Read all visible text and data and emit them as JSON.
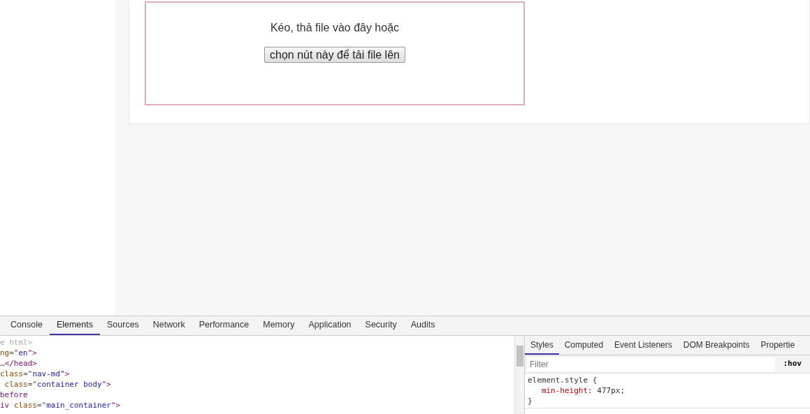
{
  "upload_box": {
    "prompt": "Kéo, thả file vào đây hoặc",
    "button": "chọn nút này để tải file lên"
  },
  "devtools": {
    "tabs": [
      {
        "label": "Console",
        "selected": false
      },
      {
        "label": "Elements",
        "selected": true
      },
      {
        "label": "Sources",
        "selected": false
      },
      {
        "label": "Network",
        "selected": false
      },
      {
        "label": "Performance",
        "selected": false
      },
      {
        "label": "Memory",
        "selected": false
      },
      {
        "label": "Application",
        "selected": false
      },
      {
        "label": "Security",
        "selected": false
      },
      {
        "label": "Audits",
        "selected": false
      }
    ],
    "dom_lines": [
      [
        {
          "kind": "doctype",
          "text": "e html>"
        }
      ],
      [
        {
          "kind": "attr",
          "text": "ng"
        },
        {
          "kind": "plain",
          "text": "=\""
        },
        {
          "kind": "value",
          "text": "en"
        },
        {
          "kind": "tag",
          "text": "\">"
        }
      ],
      [
        {
          "kind": "plain",
          "text": "…"
        },
        {
          "kind": "tag",
          "text": "</head>"
        }
      ],
      [
        {
          "kind": "attr",
          "text": "class"
        },
        {
          "kind": "plain",
          "text": "=\""
        },
        {
          "kind": "value",
          "text": "nav-md"
        },
        {
          "kind": "tag",
          "text": "\">"
        }
      ],
      [
        {
          "kind": "attr",
          "text": " class"
        },
        {
          "kind": "plain",
          "text": "=\""
        },
        {
          "kind": "value",
          "text": "container body"
        },
        {
          "kind": "tag",
          "text": "\">"
        }
      ],
      [
        {
          "kind": "pseudo",
          "text": "before"
        }
      ],
      [
        {
          "kind": "tag",
          "text": "iv "
        },
        {
          "kind": "attr",
          "text": "class"
        },
        {
          "kind": "plain",
          "text": "=\""
        },
        {
          "kind": "value",
          "text": "main_container"
        },
        {
          "kind": "tag",
          "text": "\">"
        }
      ]
    ],
    "side_tabs": [
      {
        "label": "Styles",
        "selected": true
      },
      {
        "label": "Computed",
        "selected": false
      },
      {
        "label": "Event Listeners",
        "selected": false
      },
      {
        "label": "DOM Breakpoints",
        "selected": false
      },
      {
        "label": "Propertie",
        "selected": false
      }
    ],
    "filter": {
      "placeholder": "Filter",
      "hov": ":hov"
    },
    "rule": {
      "selector": "element.style {",
      "property": "min-height",
      "separator": ":",
      "value": "477px;",
      "close": "}"
    }
  }
}
